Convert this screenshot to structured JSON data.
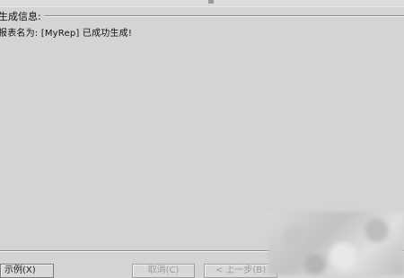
{
  "group": {
    "title": "生成信息:"
  },
  "message": "报表名为: [MyRep] 已成功生成!",
  "buttons": {
    "example": "示例(X)",
    "cancel": "取消(C)",
    "prev": "< 上一步(B)"
  }
}
